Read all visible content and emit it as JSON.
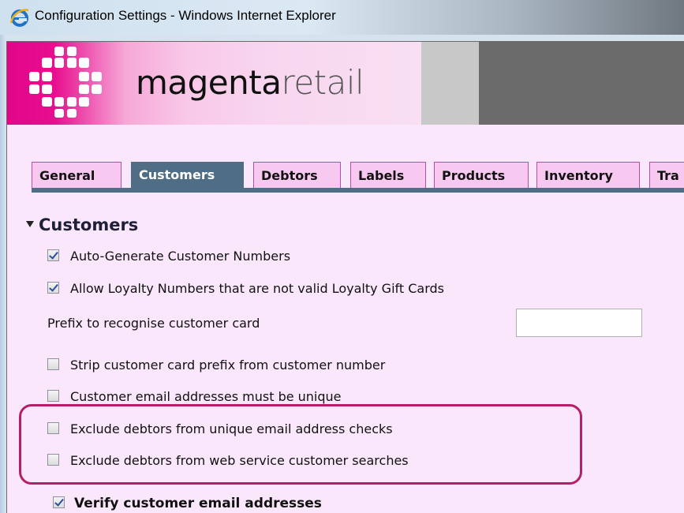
{
  "window": {
    "title": "Configuration Settings - Windows Internet Explorer"
  },
  "brand": {
    "name_part1": "magenta",
    "name_part2": "retail",
    "accent": "#e2058a"
  },
  "tabs": [
    {
      "label": "General",
      "active": false
    },
    {
      "label": "Customers",
      "active": true
    },
    {
      "label": "Debtors",
      "active": false
    },
    {
      "label": "Labels",
      "active": false
    },
    {
      "label": "Products",
      "active": false
    },
    {
      "label": "Inventory",
      "active": false
    },
    {
      "label": "Tra",
      "active": false
    }
  ],
  "section": {
    "title": "Customers",
    "items": [
      {
        "label": "Auto-Generate Customer Numbers",
        "checked": true
      },
      {
        "label": "Allow Loyalty Numbers that are not valid Loyalty Gift Cards",
        "checked": true
      },
      {
        "label": "Strip customer card prefix from customer number",
        "checked": false
      },
      {
        "label": "Customer email addresses must be unique",
        "checked": false
      },
      {
        "label": "Exclude debtors from unique email address checks",
        "checked": false
      },
      {
        "label": "Exclude debtors from web service customer searches",
        "checked": false
      }
    ],
    "prefix_label": "Prefix to recognise customer card",
    "prefix_value": "",
    "verify_label": "Verify customer email addresses",
    "verify_checked": true
  }
}
